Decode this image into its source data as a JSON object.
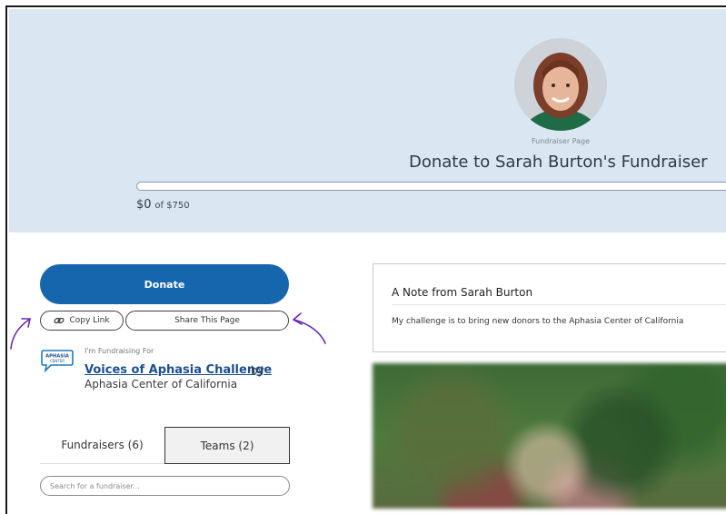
{
  "hero": {
    "subtitle": "Fundraiser Page",
    "title": "Donate to Sarah Burton's Fundraiser",
    "raised_amount": "$0",
    "goal_text": "of $750",
    "progress_fraction": 0
  },
  "actions": {
    "donate_label": "Donate",
    "copy_link_label": "Copy Link",
    "share_label": "Share This Page"
  },
  "campaign": {
    "fundraising_for_label": "I'm Fundraising For",
    "campaign_name": "Voices of Aphasia Challenge",
    "by_label": "by",
    "org_name": "Aphasia Center of California",
    "logo_text": "APHASIA CENTER"
  },
  "tabs": [
    {
      "label": "Fundraisers (6)"
    },
    {
      "label": "Teams (2)"
    }
  ],
  "search": {
    "placeholder": "Search for a fundraiser..."
  },
  "note": {
    "title": "A Note from Sarah Burton",
    "body": "My challenge is to bring new donors to the Aphasia Center of California"
  },
  "annotation_color": "#6a2bb5",
  "brand_color": "#1566ad"
}
